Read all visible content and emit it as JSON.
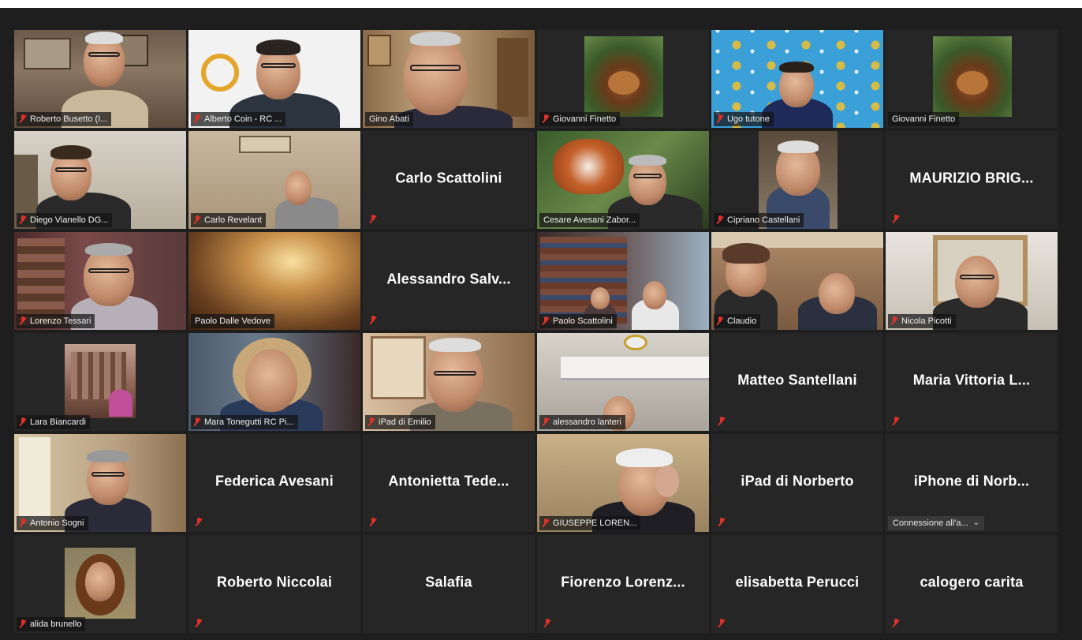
{
  "meeting": {
    "tiles": [
      {
        "name": "Roberto Busetto (I...",
        "kind": "video",
        "muted": true
      },
      {
        "name": "Alberto Coin - RC ...",
        "kind": "video",
        "muted": true
      },
      {
        "name": "Gino Abati",
        "kind": "video",
        "muted": false
      },
      {
        "name": "Giovanni Finetto",
        "kind": "picture",
        "muted": true
      },
      {
        "name": "Ugo tutone",
        "kind": "video",
        "muted": true
      },
      {
        "name": "Giovanni Finetto",
        "kind": "picture",
        "muted": false
      },
      {
        "name": "Diego Vianello DG...",
        "kind": "video",
        "muted": true
      },
      {
        "name": "Carlo Revelant",
        "kind": "video",
        "muted": true
      },
      {
        "name": "Carlo Scattolini",
        "kind": "name",
        "muted": true
      },
      {
        "name": "Cesare Avesani Zabor...",
        "kind": "video",
        "muted": false,
        "speaking": true
      },
      {
        "name": "Cipriano Castellani",
        "kind": "video",
        "muted": true
      },
      {
        "name": "MAURIZIO  BRIG...",
        "kind": "name",
        "muted": true
      },
      {
        "name": "Lorenzo Tessari",
        "kind": "video",
        "muted": true
      },
      {
        "name": "Paolo Dalle Vedove",
        "kind": "video",
        "muted": false
      },
      {
        "name": "Alessandro  Salv...",
        "kind": "name",
        "muted": true
      },
      {
        "name": "Paolo Scattolini",
        "kind": "video",
        "muted": true
      },
      {
        "name": "Claudio",
        "kind": "video",
        "muted": true
      },
      {
        "name": "Nicola Picotti",
        "kind": "video",
        "muted": true
      },
      {
        "name": "Lara Biancardi",
        "kind": "picture",
        "muted": true
      },
      {
        "name": "Mara Tonegutti RC Pi...",
        "kind": "video",
        "muted": false
      },
      {
        "name": "iPad di Emilio",
        "kind": "video",
        "muted": true
      },
      {
        "name": "alessandro lanteri",
        "kind": "video",
        "muted": true
      },
      {
        "name": "Matteo Santellani",
        "kind": "name",
        "muted": true
      },
      {
        "name": "Maria  Vittoria  L...",
        "kind": "name",
        "muted": true
      },
      {
        "name": "Antonio Sogni",
        "kind": "video",
        "muted": true
      },
      {
        "name": "Federica Avesani",
        "kind": "name",
        "muted": true
      },
      {
        "name": "Antonietta  Tede...",
        "kind": "name",
        "muted": true
      },
      {
        "name": "GIUSEPPE LOREN...",
        "kind": "video",
        "muted": true
      },
      {
        "name": "iPad di Norberto",
        "kind": "name",
        "muted": true
      },
      {
        "name": "iPhone di Norb...",
        "kind": "name",
        "muted": false,
        "status": "Connessione all'a..."
      },
      {
        "name": "alida brunello",
        "kind": "picture",
        "muted": true
      },
      {
        "name": "Roberto Niccolai",
        "kind": "name",
        "muted": true
      },
      {
        "name": "Salafia",
        "kind": "name",
        "muted": false
      },
      {
        "name": "Fiorenzo  Lorenz...",
        "kind": "name",
        "muted": true
      },
      {
        "name": "elisabetta Perucci",
        "kind": "name",
        "muted": true
      },
      {
        "name": "calogero carita",
        "kind": "name",
        "muted": true
      }
    ]
  },
  "colors": {
    "background": "#1e1e1e",
    "tile": "#262626",
    "muted_icon": "#e0302a",
    "active_speaker": "#c9d93a"
  },
  "icons": {
    "muted": "microphone-muted-icon",
    "dropdown": "chevron-down-icon"
  }
}
